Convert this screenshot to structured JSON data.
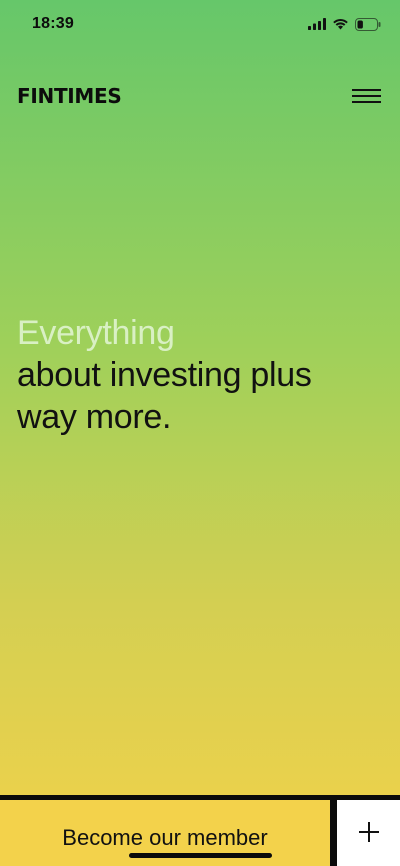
{
  "status_bar": {
    "time": "18:39",
    "icons": [
      "signal-icon",
      "wifi-icon",
      "battery-icon"
    ],
    "battery_level": 0.3
  },
  "header": {
    "brand": "FINTIMES",
    "menu_icon": "hamburger-menu-icon"
  },
  "hero": {
    "line_muted": "Everything",
    "line_1": "about investing plus",
    "line_2": "way more."
  },
  "bottom_bar": {
    "cta_label": "Become our member",
    "plus_icon": "plus-icon"
  },
  "colors": {
    "gradient_top": "#66c76a",
    "gradient_bottom": "#f2d24a",
    "cta_background": "#f3d24b",
    "muted_text": "#d9f0c4",
    "dark": "#0b0b0b"
  }
}
